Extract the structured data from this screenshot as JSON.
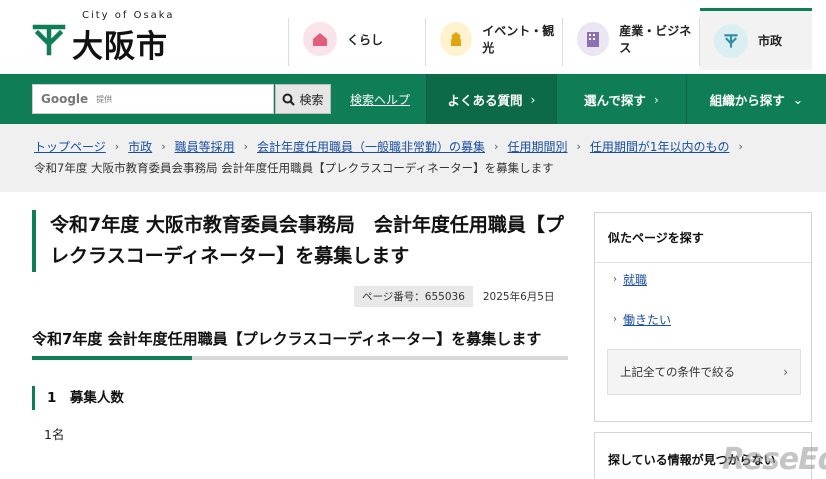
{
  "header": {
    "logo_sub": "City of Osaka",
    "logo_text": "大阪市",
    "nav": [
      {
        "label": "くらし",
        "icon": "house-icon",
        "color": "#fbe3ea",
        "iconColor": "#e45c7e"
      },
      {
        "label": "イベント・観光",
        "icon": "castle-icon",
        "color": "#fff3cf",
        "iconColor": "#e1a60f"
      },
      {
        "label": "産業・ビジネス",
        "icon": "building-icon",
        "color": "#ece6f3",
        "iconColor": "#8c6fb5"
      },
      {
        "label": "市政",
        "icon": "city-mark-icon",
        "color": "#dbeef1",
        "iconColor": "#2b8fa2"
      }
    ]
  },
  "searchbar": {
    "google": "Google",
    "google_sub": "提供",
    "button_label": "検索",
    "help_label": "検索ヘルプ",
    "menu": [
      "よくある質問",
      "選んで探す",
      "組織から探す"
    ]
  },
  "breadcrumb": {
    "items": [
      "トップページ",
      "市政",
      "職員等採用",
      "会計年度任用職員（一般職非常勤）の募集",
      "任用期間別",
      "任用期間が1年以内のもの"
    ],
    "current": "令和7年度 大阪市教育委員会事務局 会計年度任用職員【プレクラスコーディネーター】を募集します"
  },
  "main": {
    "title": "令和7年度 大阪市教育委員会事務局　会計年度任用職員【プレクラスコーディネーター】を募集します",
    "page_number": "ページ番号：655036",
    "date": "2025年6月5日",
    "h2": "令和7年度 会計年度任用職員【プレクラスコーディネーター】を募集します",
    "h3": "1　募集人数",
    "body": "1名"
  },
  "sidebar": {
    "heading": "似たページを探す",
    "links": [
      "就職",
      "働きたい"
    ],
    "filter_label": "上記全ての条件で絞る",
    "heading2": "探している情報が見つからない"
  },
  "colors": {
    "primary": "#0f7e57",
    "link": "#1a4fa0"
  },
  "watermark": "ReseEd"
}
